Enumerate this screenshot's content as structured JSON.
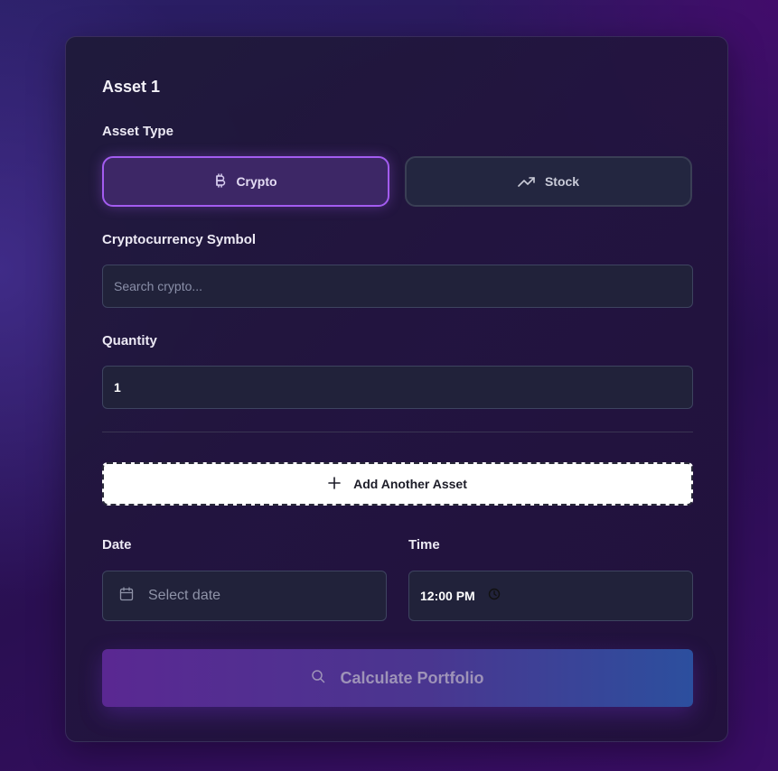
{
  "asset": {
    "title": "Asset 1",
    "type_label": "Asset Type",
    "types": [
      {
        "label": "Crypto",
        "icon": "bitcoin-icon",
        "selected": true
      },
      {
        "label": "Stock",
        "icon": "trending-up-icon",
        "selected": false
      }
    ],
    "symbol_label": "Cryptocurrency Symbol",
    "symbol_placeholder": "Search crypto...",
    "symbol_value": "",
    "quantity_label": "Quantity",
    "quantity_value": "1"
  },
  "add_asset_label": "Add Another Asset",
  "date": {
    "label": "Date",
    "placeholder": "Select date"
  },
  "time": {
    "label": "Time",
    "value": "12:00 PM"
  },
  "calculate_label": "Calculate Portfolio",
  "colors": {
    "accent": "#a35cf0",
    "selected_bg": "#3d2766",
    "input_bg": "#21223a",
    "calc_gradient_start": "#5a2892",
    "calc_gradient_end": "#2c4f9e"
  }
}
